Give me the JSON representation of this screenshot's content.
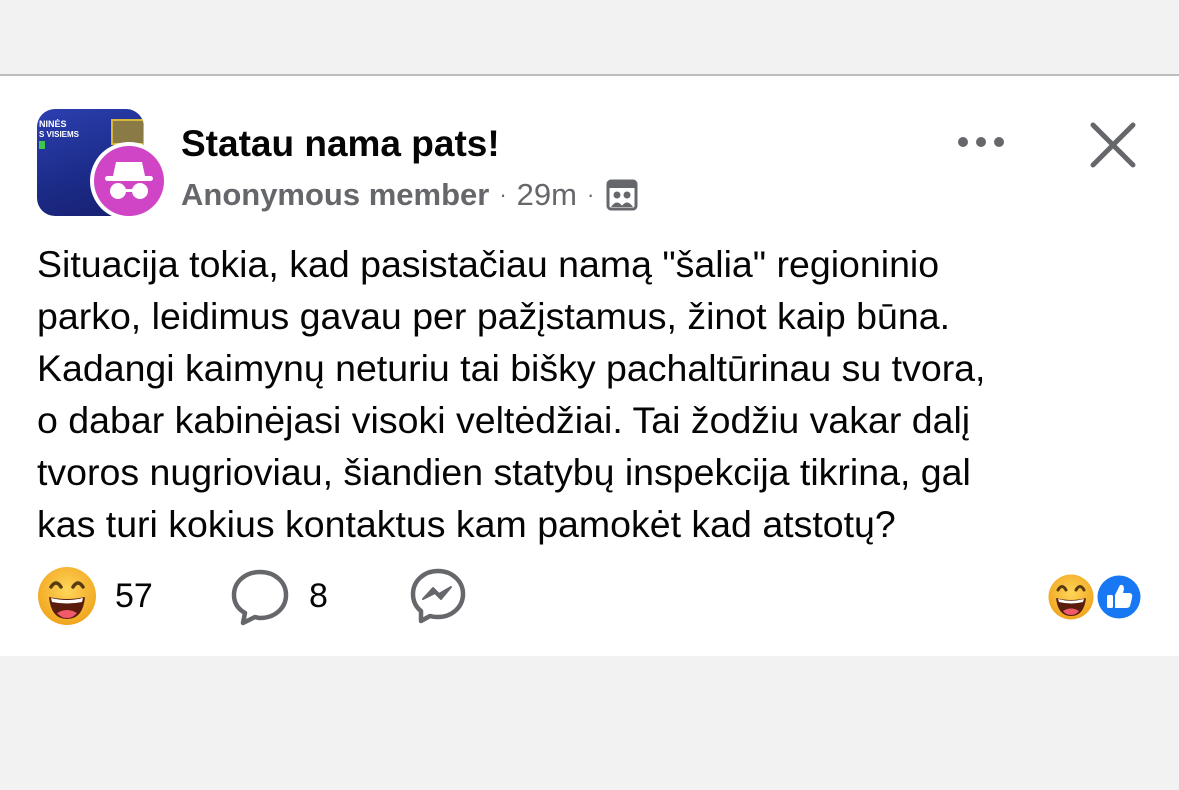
{
  "group": {
    "name": "Statau nama pats!",
    "thumbnail_text_1": "NINĖS",
    "thumbnail_text_2": "S VISIEMS",
    "avatar_color": "#cf45c6",
    "thumbnail_color": "#2c3fb0"
  },
  "post": {
    "author": "Anonymous member",
    "time": "29m",
    "separator": "·",
    "privacy_icon": "group-icon",
    "text_lines": [
      "Situacija tokia, kad pasistačiau namą \"šalia\" regioninio",
      "parko, leidimus gavau per pažįstamus, žinot kaip būna.",
      "Kadangi kaimynų neturiu tai bišky pachaltūrinau su tvora,",
      "o dabar kabinėjasi visoki veltėdžiai. Tai žodžiu vakar dalį",
      "tvoros nugrioviau, šiandien statybų inspekcija tikrina, gal",
      "kas turi kokius kontaktus kam pamokėt kad atstotų?"
    ]
  },
  "actions": {
    "reaction_icon": "laughing-emoji-icon",
    "reaction_count": "57",
    "comment_icon": "comment-bubble-icon",
    "comment_count": "8",
    "share_icon": "messenger-icon",
    "summary_icons": [
      "laughing-emoji-icon",
      "like-thumb-icon"
    ]
  },
  "header_icons": {
    "more": "more-horizontal-icon",
    "close": "close-icon"
  },
  "colors": {
    "like_blue": "#1877f2",
    "secondary_text": "#65676b",
    "emoji_yellow": "#f7b125"
  }
}
